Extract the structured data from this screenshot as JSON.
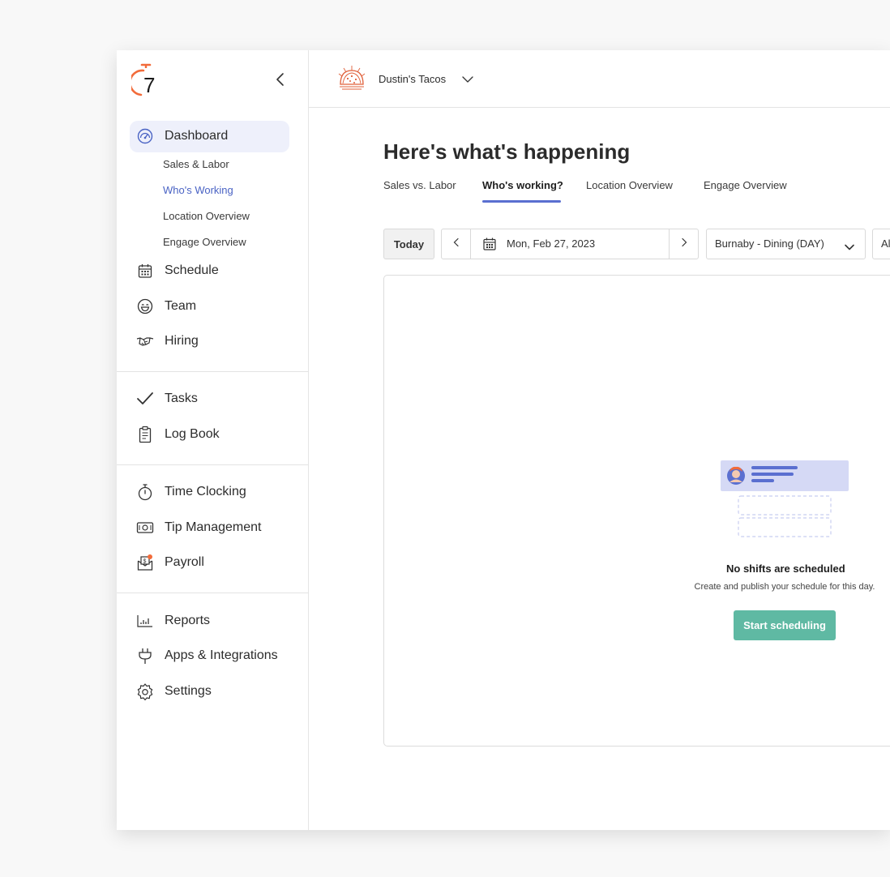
{
  "sidebar": {
    "logo_text": "7",
    "nav": {
      "dashboard": {
        "label": "Dashboard",
        "icon": "gauge-icon"
      },
      "sub_items": [
        {
          "label": "Sales & Labor"
        },
        {
          "label": "Who's Working",
          "active": true
        },
        {
          "label": "Location Overview"
        },
        {
          "label": "Engage Overview"
        }
      ],
      "schedule": {
        "label": "Schedule",
        "icon": "calendar-icon"
      },
      "team": {
        "label": "Team",
        "icon": "smiley-icon"
      },
      "hiring": {
        "label": "Hiring",
        "icon": "handshake-icon"
      },
      "tasks": {
        "label": "Tasks",
        "icon": "checkmark-icon"
      },
      "log_book": {
        "label": "Log Book",
        "icon": "clipboard-icon"
      },
      "time_clocking": {
        "label": "Time Clocking",
        "icon": "stopwatch-icon"
      },
      "tip_management": {
        "label": "Tip Management",
        "icon": "cash-icon"
      },
      "payroll": {
        "label": "Payroll",
        "icon": "payroll-icon"
      },
      "reports": {
        "label": "Reports",
        "icon": "bar-chart-icon"
      },
      "apps": {
        "label": "Apps & Integrations",
        "icon": "plug-icon"
      },
      "settings": {
        "label": "Settings",
        "icon": "gear-icon"
      }
    }
  },
  "header": {
    "business_name": "Dustin's Tacos"
  },
  "main": {
    "title": "Here's what's happening",
    "tabs": [
      {
        "label": "Sales vs. Labor"
      },
      {
        "label": "Who's working?",
        "active": true
      },
      {
        "label": "Location Overview"
      },
      {
        "label": "Engage Overview"
      }
    ],
    "filters": {
      "today_label": "Today",
      "date": "Mon, Feb 27, 2023",
      "location": "Burnaby - Dining (DAY)",
      "partial_select": "Al"
    },
    "empty_state": {
      "title": "No shifts are scheduled",
      "subtitle": "Create and publish your schedule for this day.",
      "button_label": "Start scheduling"
    }
  },
  "colors": {
    "accent": "#4a63c4",
    "active_nav_bg": "#eef0fb",
    "brand_orange": "#f26b3a",
    "button_teal": "#5fb9a3",
    "tab_underline": "#5a6fd0"
  }
}
